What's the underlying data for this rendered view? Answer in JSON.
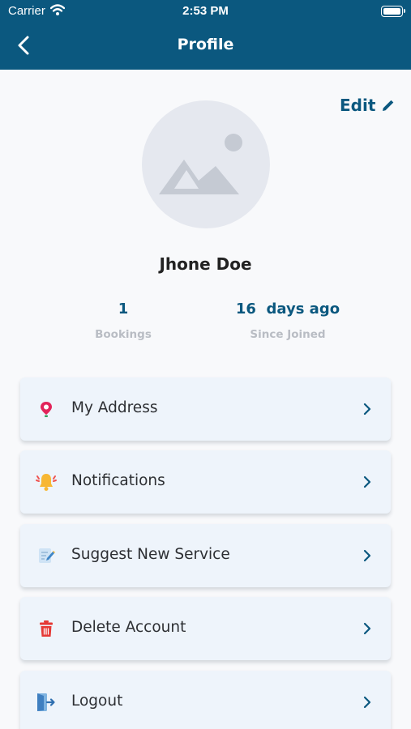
{
  "status_bar": {
    "carrier": "Carrier",
    "time": "2:53 PM"
  },
  "header": {
    "title": "Profile",
    "back_icon": "chevron-left-icon"
  },
  "profile": {
    "edit_label": "Edit",
    "edit_icon": "pencil-icon",
    "avatar_icon": "image-placeholder-icon",
    "name": "Jhone Doe",
    "stats": [
      {
        "value": "1",
        "label": "Bookings"
      },
      {
        "value": "16  days ago",
        "label": "Since Joined"
      }
    ]
  },
  "menu": [
    {
      "label": "My Address",
      "icon": "map-pin-icon"
    },
    {
      "label": "Notifications",
      "icon": "bell-icon"
    },
    {
      "label": "Suggest New Service",
      "icon": "note-edit-icon"
    },
    {
      "label": "Delete Account",
      "icon": "trash-icon"
    },
    {
      "label": "Logout",
      "icon": "logout-icon"
    }
  ],
  "colors": {
    "brand": "#0b587f",
    "card": "#eef4fb",
    "page": "#f8f9fb"
  }
}
